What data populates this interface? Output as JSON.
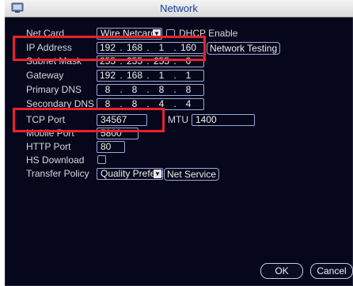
{
  "window": {
    "title": "Network"
  },
  "fields": {
    "net_card": {
      "label": "Net Card",
      "value": "Wire Netcard",
      "dhcp_label": "DHCP Enable"
    },
    "ip_address": {
      "label": "IP Address",
      "octets": [
        "192",
        "168",
        "1",
        "160"
      ],
      "action": "Network Testing"
    },
    "subnet_mask": {
      "label": "Subnet Mask",
      "octets": [
        "255",
        "255",
        "255",
        "0"
      ]
    },
    "gateway": {
      "label": "Gateway",
      "octets": [
        "192",
        "168",
        "1",
        "1"
      ]
    },
    "primary_dns": {
      "label": "Primary DNS",
      "octets": [
        "8",
        "8",
        "8",
        "8"
      ]
    },
    "secondary_dns": {
      "label": "Secondary DNS",
      "octets": [
        "8",
        "8",
        "4",
        "4"
      ]
    },
    "tcp_port": {
      "label": "TCP Port",
      "value": "34567"
    },
    "mtu": {
      "label": "MTU",
      "value": "1400"
    },
    "mobile_port": {
      "label": "Mobile Port",
      "value": "5800"
    },
    "http_port": {
      "label": "HTTP Port",
      "value": "80"
    },
    "hs_download": {
      "label": "HS Download"
    },
    "transfer_policy": {
      "label": "Transfer Policy",
      "value": "Quality Preference",
      "action": "Net Service"
    }
  },
  "buttons": {
    "ok": "OK",
    "cancel": "Cancel"
  },
  "colors": {
    "background": "#06071a",
    "highlight": "#e8222d",
    "title_text": "#1a3d9a"
  },
  "icons": {
    "title": "network-settings-icon",
    "dropdown": "chevron-down-icon"
  }
}
